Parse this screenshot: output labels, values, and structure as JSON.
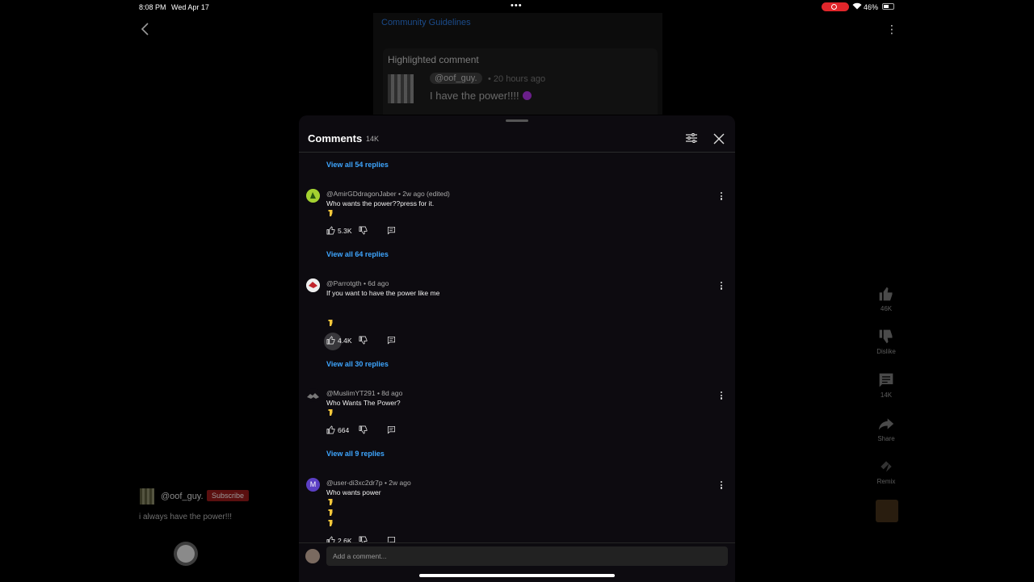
{
  "status_bar": {
    "time": "8:08 PM",
    "date": "Wed Apr 17",
    "battery": "46%"
  },
  "video_bg": {
    "community_link": "Community Guidelines",
    "highlighted": {
      "title": "Highlighted comment",
      "user": "@oof_guy.",
      "time": "• 20 hours ago",
      "text": "I have the power!!!!"
    },
    "channel": {
      "name": "@oof_guy.",
      "subscribe": "Subscribe",
      "caption": "i always have the power!!!"
    },
    "actions": {
      "likes": "46K",
      "dislike": "Dislike",
      "comments": "14K",
      "share": "Share",
      "remix": "Remix"
    }
  },
  "sheet": {
    "title": "Comments",
    "count": "14K",
    "input_placeholder": "Add a comment..."
  },
  "comments": [
    {
      "replies_before": "View all 54 replies"
    },
    {
      "user": "@AmirGDdragonJaber",
      "time": "• 2w ago (edited)",
      "text": "Who wants the power??press for it.",
      "likes": "5.3K",
      "replies": "View all 64 replies"
    },
    {
      "user": "@Parrotgth",
      "time": "• 6d ago",
      "text": "If you want to have the power like me",
      "likes": "4.4K",
      "replies": "View all 30 replies"
    },
    {
      "user": "@MuslimYT291",
      "time": "• 8d ago",
      "text": "Who Wants The Power?",
      "likes": "664",
      "replies": "View all 9 replies"
    },
    {
      "user": "@user-di3xc2dr7p",
      "time": "• 2w ago",
      "text": "Who wants power",
      "likes": "2.6K",
      "avatar_letter": "M"
    }
  ],
  "colors": {
    "accent_link": "#3ea6ff",
    "sheet_bg": "#0d0b10",
    "avatar_m": "#5b3fc4",
    "subscribe_bg": "#5a0f0f"
  },
  "icons": [
    "back-icon",
    "more-vert-icon",
    "filter-icon",
    "close-icon",
    "thumbs-up-icon",
    "thumbs-down-icon",
    "reply-icon",
    "comment-icon",
    "share-icon",
    "remix-icon",
    "pointing-down-emoji"
  ]
}
